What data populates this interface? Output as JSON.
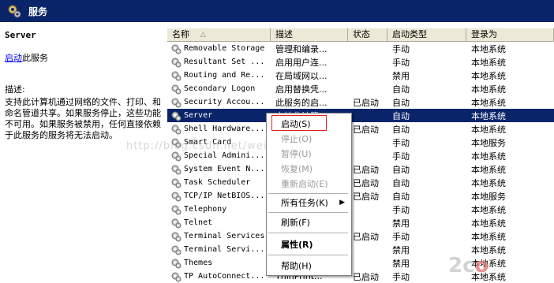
{
  "header": {
    "title": "服务"
  },
  "left": {
    "service_name": "Server",
    "start_link": "启动",
    "start_suffix": "此服务",
    "desc_label": "描述:",
    "desc_text": "支持此计算机通过网络的文件、打印、和命名管道共享。如果服务停止，这些功能不可用。如果服务被禁用，任何直接依赖于此服务的服务将无法启动。"
  },
  "columns": {
    "name": "名称",
    "sort_arrow": "△",
    "desc": "描述",
    "status": "状态",
    "type": "启动类型",
    "logon": "登录为"
  },
  "rows": [
    {
      "name": "Removable Storage",
      "desc": "管理和编录...",
      "status": "",
      "type": "手动",
      "logon": "本地系统"
    },
    {
      "name": "Resultant Set ...",
      "desc": "启用用户连...",
      "status": "",
      "type": "手动",
      "logon": "本地系统"
    },
    {
      "name": "Routing and Re...",
      "desc": "在局域网以...",
      "status": "",
      "type": "禁用",
      "logon": "本地系统"
    },
    {
      "name": "Secondary Logon",
      "desc": "启用替换凭...",
      "status": "",
      "type": "自动",
      "logon": "本地系统"
    },
    {
      "name": "Security Accou...",
      "desc": "此服务的启...",
      "status": "已启动",
      "type": "自动",
      "logon": "本地系统"
    },
    {
      "name": "Server",
      "desc": "支持此计算...",
      "status": "",
      "type": "自动",
      "logon": "本地系统"
    },
    {
      "name": "Shell Hardware...",
      "desc": "",
      "status": "已启动",
      "type": "自动",
      "logon": "本地系统"
    },
    {
      "name": "Smart Card",
      "desc": "",
      "status": "",
      "type": "手动",
      "logon": "本地服务"
    },
    {
      "name": "Special Admini...",
      "desc": "",
      "status": "",
      "type": "手动",
      "logon": "本地系统"
    },
    {
      "name": "System Event N...",
      "desc": "",
      "status": "已启动",
      "type": "自动",
      "logon": "本地系统"
    },
    {
      "name": "Task Scheduler",
      "desc": "",
      "status": "已启动",
      "type": "自动",
      "logon": "本地系统"
    },
    {
      "name": "TCP/IP NetBIOS...",
      "desc": "",
      "status": "已启动",
      "type": "自动",
      "logon": "本地服务"
    },
    {
      "name": "Telephony",
      "desc": "",
      "status": "",
      "type": "手动",
      "logon": "本地系统"
    },
    {
      "name": "Telnet",
      "desc": "",
      "status": "",
      "type": "禁用",
      "logon": "本地系统"
    },
    {
      "name": "Terminal Services",
      "desc": "",
      "status": "已启动",
      "type": "手动",
      "logon": "本地系统"
    },
    {
      "name": "Terminal Servi...",
      "desc": "",
      "status": "",
      "type": "禁用",
      "logon": "本地系统"
    },
    {
      "name": "Themes",
      "desc": "",
      "status": "",
      "type": "禁用",
      "logon": "本地系统"
    },
    {
      "name": "TP AutoConnect...",
      "desc": "ThinPrint...",
      "status": "已启动",
      "type": "手动",
      "logon": "本地系统"
    }
  ],
  "menu": {
    "start": "启动(S)",
    "stop": "停止(O)",
    "pause": "暂停(U)",
    "resume": "恢复(M)",
    "restart": "重新启动(E)",
    "all_tasks": "所有任务(K)",
    "refresh": "刷新(F)",
    "properties": "属性(R)",
    "help": "帮助(H)"
  },
  "watermark": "http://blog.csdn.net/weihaodong2613",
  "colors": {
    "title_bar": "#0a246a",
    "selection": "#0a246a",
    "highlight_box": "#e02020"
  }
}
